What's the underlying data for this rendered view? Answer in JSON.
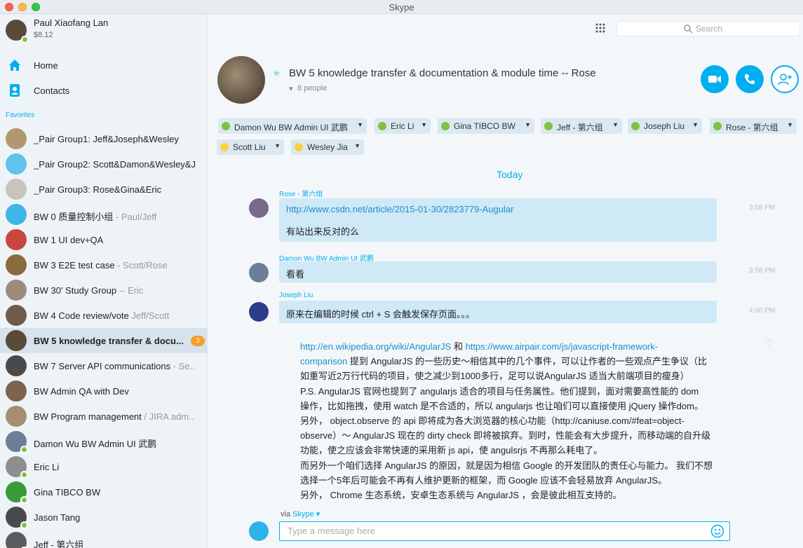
{
  "window": {
    "title": "Skype"
  },
  "profile": {
    "name": "Paul Xiaofang Lan",
    "credit": "$8.12"
  },
  "nav": [
    {
      "label": "Home"
    },
    {
      "label": "Contacts"
    }
  ],
  "favorites_label": "Favorites",
  "contacts": [
    {
      "name": "_Pair Group1: Jeff&Joseph&Wesley",
      "sub": "",
      "status": "none",
      "avatar_color": "#b49770"
    },
    {
      "name": "_Pair Group2: Scott&Damon&Wesley&J...",
      "sub": "",
      "status": "none",
      "avatar_color": "#5fc4ea"
    },
    {
      "name": "_Pair Group3: Rose&Gina&Eric",
      "sub": "",
      "status": "none",
      "avatar_color": "#c9c4ba"
    },
    {
      "name": "BW 0 质量控制小组",
      "sub": " - Paul/Jeff",
      "status": "none",
      "avatar_color": "#3fb6e6"
    },
    {
      "name": "BW 1 UI dev+QA",
      "sub": "",
      "status": "none",
      "avatar_color": "#c7463f"
    },
    {
      "name": "BW 3 E2E test case",
      "sub": " - Scott/Rose",
      "status": "none",
      "avatar_color": "#8a6b3c"
    },
    {
      "name": "BW 30' Study Group",
      "sub": " -- Eric",
      "status": "none",
      "avatar_color": "#9d8c7a"
    },
    {
      "name": "BW 4 Code review/vote",
      "sub": " Jeff/Scott",
      "status": "none",
      "avatar_color": "#6e5c4a"
    },
    {
      "name": "BW 5 knowledge transfer & docu...",
      "sub": "",
      "status": "none",
      "avatar_color": "#5a4a3a",
      "active": true,
      "badge": "3"
    },
    {
      "name": "BW 7 Server API communications",
      "sub": " - Se...",
      "status": "none",
      "avatar_color": "#4a4a4a"
    },
    {
      "name": "BW Admin QA with Dev",
      "sub": "",
      "status": "none",
      "avatar_color": "#7d6450"
    },
    {
      "name": "BW Program management",
      "sub": " / JIRA adm...",
      "status": "none",
      "avatar_color": "#a58f6f"
    },
    {
      "name": "Damon Wu BW Admin UI 武鹏",
      "sub": "",
      "status": "online",
      "avatar_color": "#6c7f9a"
    },
    {
      "name": "Eric Li",
      "sub": "",
      "status": "online",
      "avatar_color": "#8e8e8e"
    },
    {
      "name": "Gina TIBCO BW",
      "sub": "",
      "status": "online",
      "avatar_color": "#3a9a3a"
    },
    {
      "name": "Jason Tang",
      "sub": "",
      "status": "online",
      "avatar_color": "#4a4a4a"
    },
    {
      "name": "Jeff - 第六组",
      "sub": "",
      "status": "online",
      "avatar_color": "#5c5c5c"
    }
  ],
  "search": {
    "placeholder": "Search"
  },
  "conversation": {
    "title": "BW 5 knowledge transfer & documentation & module time -- Rose",
    "people": "8 people",
    "participants": [
      {
        "label": "Damon Wu BW Admin UI 武鹏",
        "status": "online"
      },
      {
        "label": "Eric Li",
        "status": "online"
      },
      {
        "label": "Gina TIBCO BW",
        "status": "online"
      },
      {
        "label": "Jeff - 第六组",
        "status": "online"
      },
      {
        "label": "Joseph Liu",
        "status": "online"
      },
      {
        "label": "Rose - 第六组",
        "status": "online"
      },
      {
        "label": "Scott Liu",
        "status": "away"
      },
      {
        "label": "Wesley Jia",
        "status": "away"
      }
    ],
    "day": "Today",
    "messages": [
      {
        "author": "Rose - 第六组",
        "link": "http://www.csdn.net/article/2015-01-30/2823779-Augular",
        "text": "有站出来反对的么",
        "time": "3:58 PM"
      },
      {
        "author": "Damon Wu BW Admin UI 武鹏",
        "text": "看看",
        "time": "3:58 PM"
      },
      {
        "author": "Joseph Liu",
        "text": "原来在编辑的时候 ctrl + S 会触发保存页面。。。",
        "time": "4:00 PM"
      }
    ],
    "long_message": {
      "link1": "http://en.wikipedia.org/wiki/AngularJS",
      "and": " 和 ",
      "link2": "https://www.airpair.com/js/javascript-framework-",
      "link2b": "comparison",
      "lines": [
        " 提到 AngularJS 的一些历史～相信其中的几个事件，可以让作者的一些观点产生争议（比",
        "如重写近2万行代码的项目，使之减少到1000多行，足可以说AngularJS 适当大前端项目的瘦身）",
        "P.S. AngularJS 官网也提到了 angularjs 适合的项目与任务属性。他们提到，面对需要高性能的 dom",
        "操作，比如拖拽，使用 watch 是不合适的，所以 angularjs 也让咱们可以直接使用 jQuery 操作dom。",
        "另外， object.observe 的 api 即将成为各大浏览器的核心功能（http://caniuse.com/#feat=object-",
        "observe）～ AngularJS 现在的 dirty check 即将被摈弃。到时，性能会有大步提升，而移动端的自升级",
        "功能，使之应该会非常快速的采用新 js api，使 angulsrjs 不再那么耗电了。",
        "而另外一个咱们选择 AngularJS 的原因，就是因为相信 Google 的开发团队的责任心与能力。 我们不想",
        "选择一个5年后可能会不再有人维护更新的框架，而 Google 应该不会轻易放弃 AngularJS。",
        "另外， Chrome 生态系统，安卓生态系统与 AngularJS ，会是彼此相互支持的。"
      ]
    },
    "via": "via",
    "via_link": "Skype ▾",
    "composer_placeholder": "Type a message here"
  },
  "colors": {
    "accent": "#00aff0",
    "online": "#7dc243",
    "away": "#f9d23b",
    "bubble": "#cfe9f7",
    "badge": "#f89d2a"
  },
  "icons": [
    "home-icon",
    "contacts-icon",
    "dialpad-icon",
    "search-icon",
    "video-call-icon",
    "call-icon",
    "add-people-icon",
    "star-icon",
    "emoji-icon",
    "heart-icon"
  ]
}
